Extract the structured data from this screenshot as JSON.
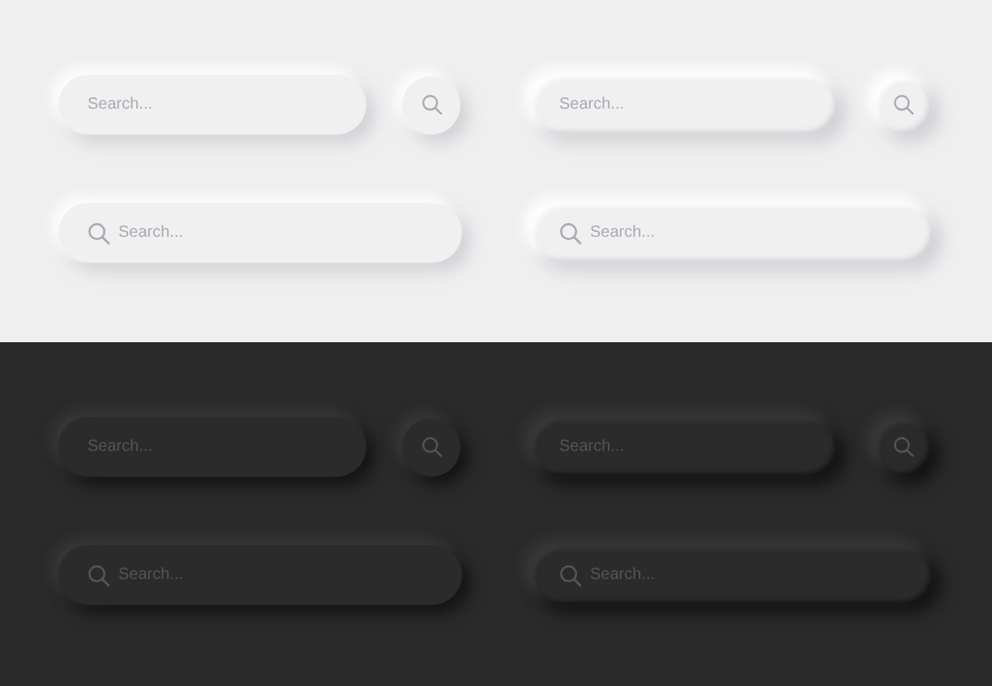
{
  "panels": [
    {
      "kind": "light",
      "variants": [
        {
          "kind": "flat",
          "short_field": {
            "placeholder": "Search..."
          },
          "wide_field": {
            "placeholder": "Search..."
          }
        },
        {
          "kind": "bevel",
          "short_field": {
            "placeholder": "Search..."
          },
          "wide_field": {
            "placeholder": "Search..."
          }
        }
      ]
    },
    {
      "kind": "dark",
      "variants": [
        {
          "kind": "flat",
          "short_field": {
            "placeholder": "Search..."
          },
          "wide_field": {
            "placeholder": "Search..."
          }
        },
        {
          "kind": "bevel",
          "short_field": {
            "placeholder": "Search..."
          },
          "wide_field": {
            "placeholder": "Search..."
          }
        }
      ]
    }
  ]
}
